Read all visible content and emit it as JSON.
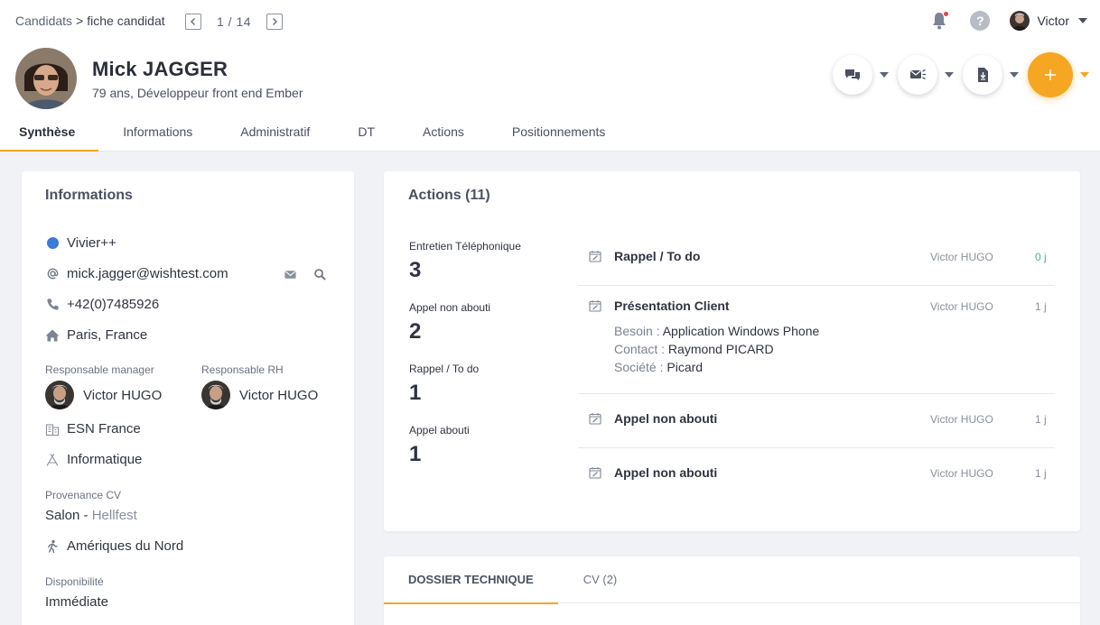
{
  "breadcrumb": {
    "parent": "Candidats",
    "separator": ">",
    "current": "fiche candidat"
  },
  "pager": {
    "text": "1 / 14"
  },
  "user": {
    "name": "Victor"
  },
  "profile": {
    "name": "Mick JAGGER",
    "subtitle": "79 ans, Développeur front end Ember"
  },
  "tabs": [
    {
      "label": "Synthèse",
      "active": true
    },
    {
      "label": "Informations"
    },
    {
      "label": "Administratif"
    },
    {
      "label": "DT"
    },
    {
      "label": "Actions"
    },
    {
      "label": "Positionnements"
    }
  ],
  "info": {
    "title": "Informations",
    "status": "Vivier++",
    "email": "mick.jagger@wishtest.com",
    "phone": "+42(0)7485926",
    "location": "Paris, France",
    "manager_label": "Responsable manager",
    "manager_name": "Victor HUGO",
    "rh_label": "Responsable RH",
    "rh_name": "Victor HUGO",
    "company": "ESN France",
    "sector": "Informatique",
    "source_label": "Provenance CV",
    "source_type": "Salon",
    "source_sep": " - ",
    "source_detail": "Hellfest",
    "mobility": "Amériques du Nord",
    "availability_label": "Disponibilité",
    "availability": "Immédiate"
  },
  "actions": {
    "title": "Actions (11)",
    "stats": [
      {
        "label": "Entretien Téléphonique",
        "value": "3"
      },
      {
        "label": "Appel non abouti",
        "value": "2"
      },
      {
        "label": "Rappel / To do",
        "value": "1"
      },
      {
        "label": "Appel abouti",
        "value": "1"
      }
    ],
    "items": [
      {
        "title": "Rappel / To do",
        "who": "Victor HUGO",
        "age": "0 j"
      },
      {
        "title": "Présentation Client",
        "who": "Victor HUGO",
        "age": "1 j",
        "details": [
          {
            "key": "Besoin :",
            "value": "Application Windows Phone"
          },
          {
            "key": "Contact :",
            "value": "Raymond PICARD"
          },
          {
            "key": "Société :",
            "value": "Picard"
          }
        ]
      },
      {
        "title": "Appel non abouti",
        "who": "Victor HUGO",
        "age": "1 j"
      },
      {
        "title": "Appel non abouti",
        "who": "Victor HUGO",
        "age": "1 j"
      }
    ]
  },
  "bottom_tabs": [
    {
      "label": "DOSSIER TECHNIQUE",
      "active": true
    },
    {
      "label": "CV (2)"
    }
  ],
  "colors": {
    "accent": "#f5a623",
    "status_blue": "#3a7bd5",
    "success_green": "#3fb986",
    "notification_red": "#e8434a"
  },
  "icons": [
    "chevron-left-icon",
    "chevron-right-icon",
    "bell-icon",
    "help-icon",
    "chat-icon",
    "mail-send-icon",
    "document-download-icon",
    "plus-icon",
    "at-icon",
    "phone-icon",
    "home-icon",
    "building-icon",
    "sector-icon",
    "walking-icon",
    "calendar-edit-icon",
    "mail-icon",
    "search-icon"
  ]
}
